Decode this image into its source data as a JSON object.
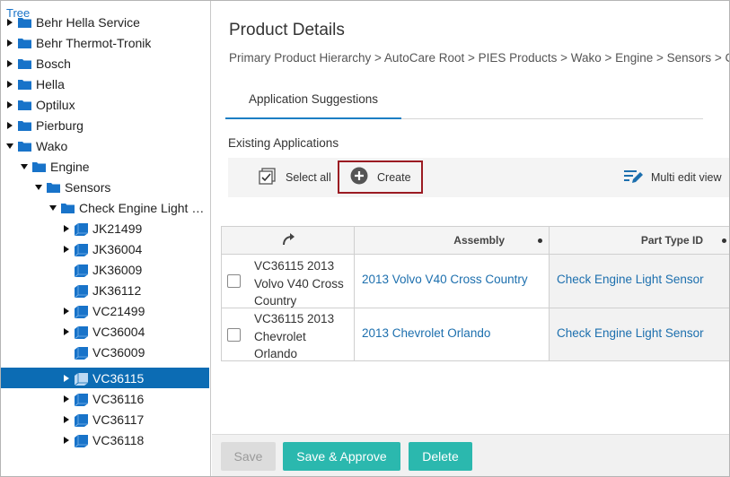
{
  "tree": {
    "title": "Tree",
    "nodes": [
      {
        "label": "Behr Hella Service"
      },
      {
        "label": "Behr Thermot-Tronik"
      },
      {
        "label": "Bosch"
      },
      {
        "label": "Hella"
      },
      {
        "label": "Optilux"
      },
      {
        "label": "Pierburg"
      },
      {
        "label": "Wako"
      },
      {
        "label": "Engine"
      },
      {
        "label": "Sensors"
      },
      {
        "label": "Check Engine Light Se..."
      },
      {
        "label": "JK21499"
      },
      {
        "label": "JK36004"
      },
      {
        "label": "JK36009"
      },
      {
        "label": "JK36112"
      },
      {
        "label": "VC21499"
      },
      {
        "label": "VC36004"
      },
      {
        "label": "VC36009"
      },
      {
        "label": "VC36115"
      },
      {
        "label": "VC36116"
      },
      {
        "label": "VC36117"
      },
      {
        "label": "VC36118"
      }
    ]
  },
  "main": {
    "page_title": "Product Details",
    "breadcrumb": "Primary Product Hierarchy > AutoCare Root > PIES Products > Wako > Engine > Sensors > C",
    "tab_label": "Application Suggestions",
    "section_label": "Existing Applications",
    "toolbar": {
      "select_all": "Select all",
      "create": "Create",
      "multi_edit": "Multi edit view"
    },
    "grid": {
      "columns": [
        "",
        "Assembly",
        "Part Type ID"
      ],
      "rows": [
        {
          "name": "VC36115 2013 Volvo V40 Cross Country",
          "assembly": "2013 Volvo V40 Cross Country",
          "part_type": "Check Engine Light Sensor"
        },
        {
          "name": "VC36115 2013 Chevrolet Orlando",
          "assembly": "2013 Chevrolet Orlando",
          "part_type": "Check Engine Light Sensor"
        }
      ]
    },
    "footer": {
      "save": "Save",
      "save_approve": "Save & Approve",
      "delete": "Delete"
    }
  },
  "colors": {
    "selection": "#0c6cb4",
    "accent": "#1c7fc4",
    "teal_button": "#2bb8ae",
    "create_border": "#9b1b22",
    "folder": "#1873c9"
  }
}
